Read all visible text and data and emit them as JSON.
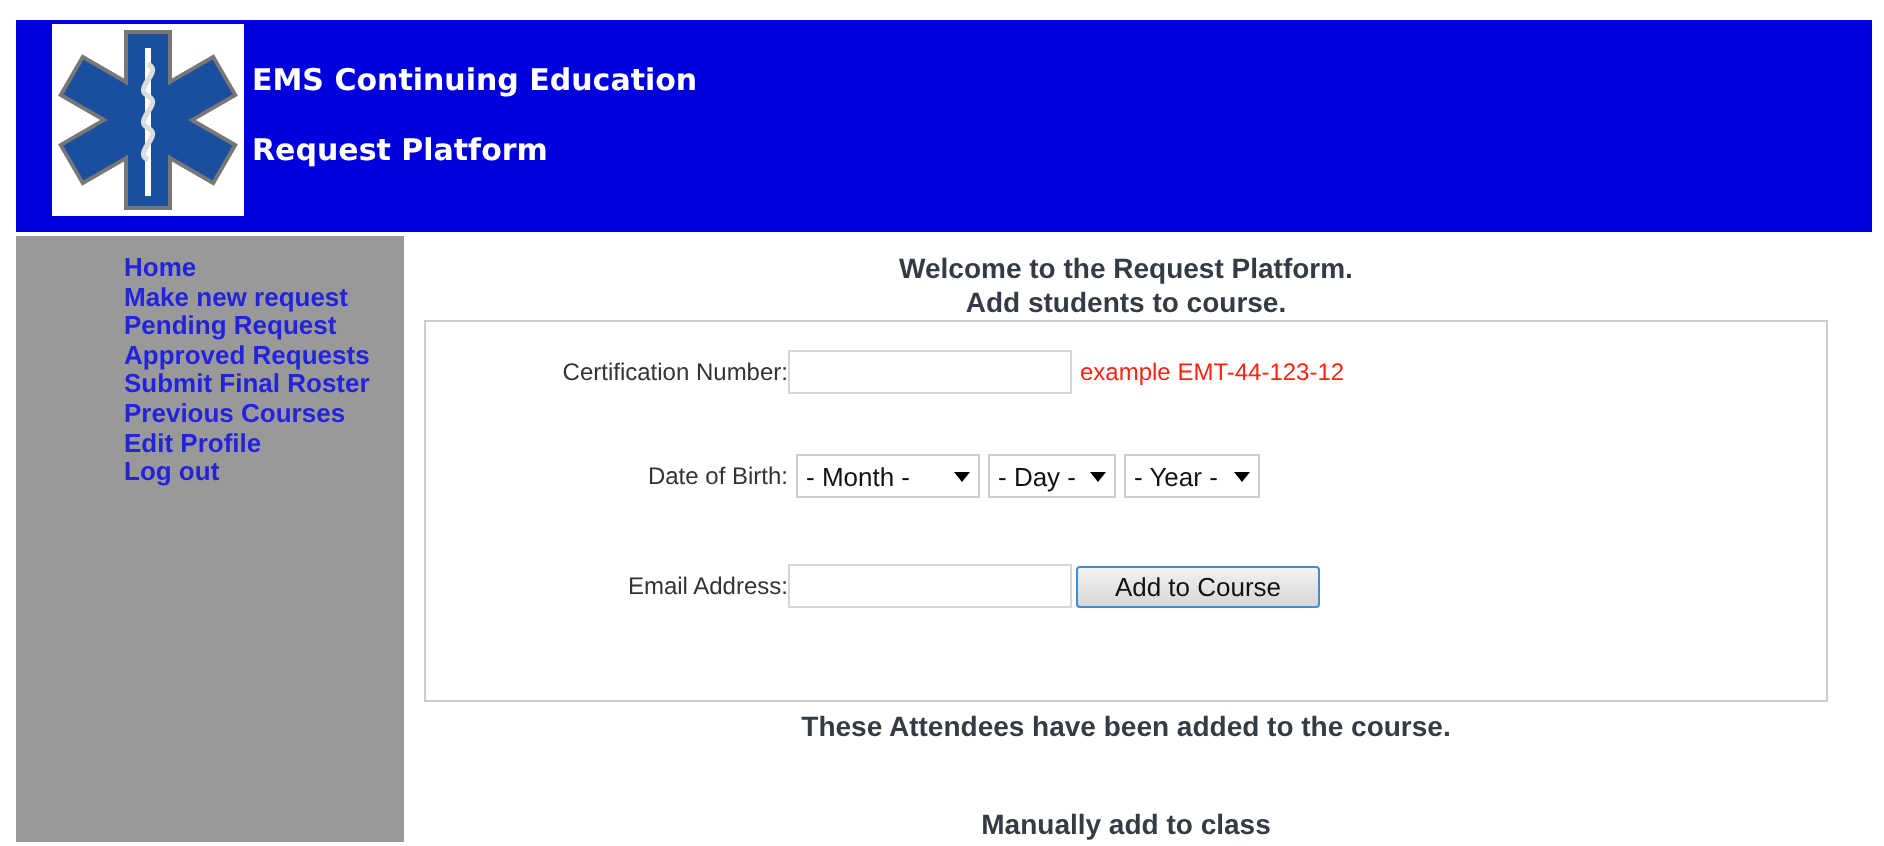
{
  "header": {
    "title_lines": [
      "EMS Continuing Education",
      "Request Platform"
    ]
  },
  "sidebar": {
    "items": [
      {
        "label": "Home"
      },
      {
        "label": "Make new request"
      },
      {
        "label": "Pending Request"
      },
      {
        "label": "Approved Requests"
      },
      {
        "label": "Submit Final Roster"
      },
      {
        "label": "Previous Courses"
      },
      {
        "label": "Edit Profile"
      },
      {
        "label": "Log out"
      }
    ]
  },
  "main": {
    "heading_lines": [
      "Welcome to the Request Platform.",
      "Add students to course."
    ],
    "form": {
      "certification": {
        "label": "Certification Number:",
        "hint": "example EMT-44-123-12"
      },
      "birth": {
        "label": "Date of Birth:",
        "dropdowns": [
          {
            "value": "- Month -"
          },
          {
            "value": "- Day -"
          },
          {
            "value": "- Year -"
          }
        ]
      },
      "email": {
        "label": "Email Address:"
      },
      "button": "Add to Course"
    },
    "attendees_note": "These Attendees have been added to the course.",
    "manual_heading": "Manually add to class"
  }
}
